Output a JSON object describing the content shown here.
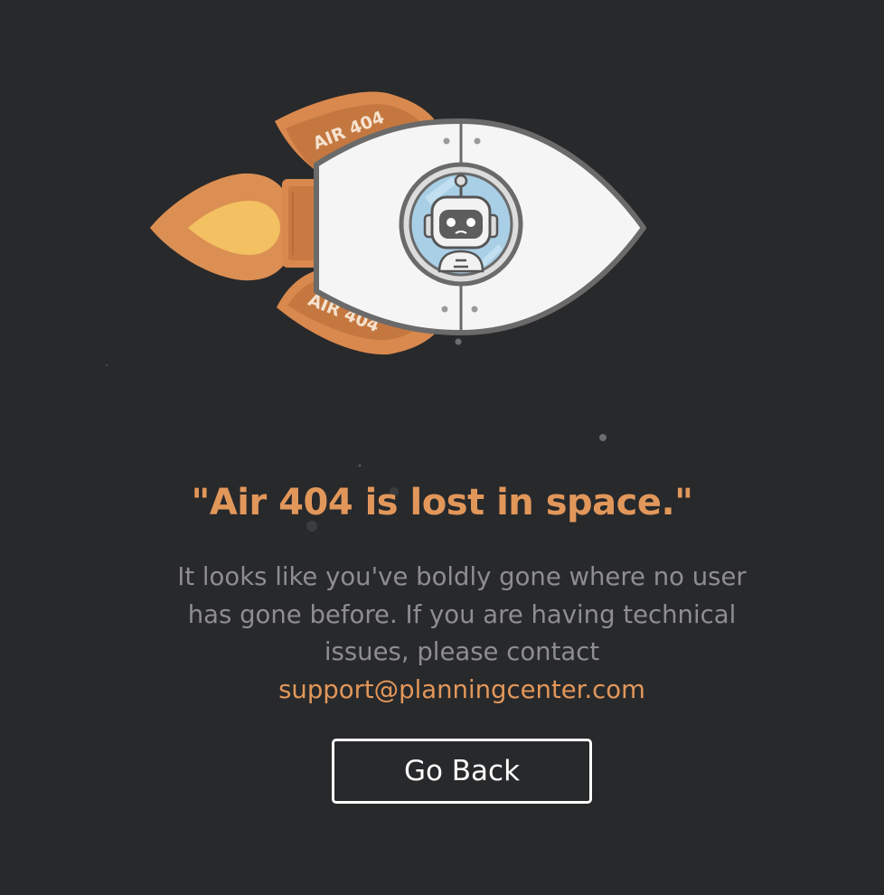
{
  "illustration": {
    "top_fin_text": "AIR 404",
    "bottom_fin_text": "AIR 404"
  },
  "headline": "\"Air 404 is lost in space.\"",
  "message": {
    "text": "It looks like you've boldly gone where no user has gone before. If you are having technical issues, please contact",
    "email": "support@planningcenter.com"
  },
  "back_button": {
    "label": "Go Back"
  },
  "colors": {
    "background": "#28292b",
    "accent": "#e2975a",
    "body_text": "#8e8e91",
    "button_border": "#ffffff",
    "fin": "#d9894e",
    "flame_outer": "#dc8f52",
    "flame_inner": "#f3c062",
    "hull": "#f5f5f5",
    "hull_outline": "#6a6a6a"
  }
}
